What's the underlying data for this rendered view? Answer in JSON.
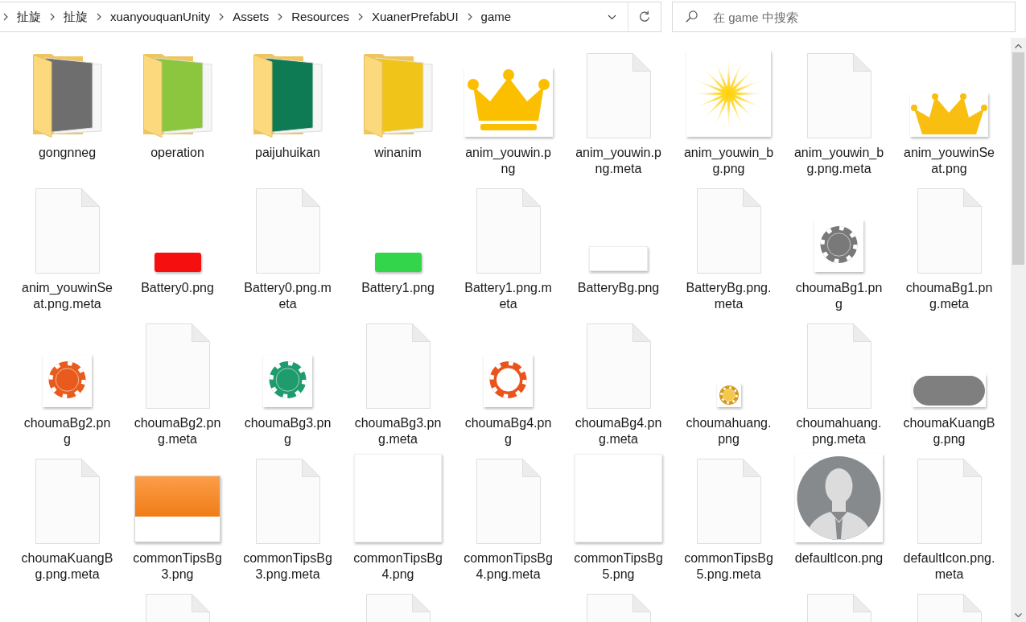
{
  "address_bar": {
    "path": [
      "扯旋",
      "扯旋",
      "xuanyouquanUnity",
      "Assets",
      "Resources",
      "XuanerPrefabUI",
      "game"
    ]
  },
  "search": {
    "placeholder": "在 game 中搜索"
  },
  "items": [
    {
      "name": "gongnneg",
      "kind": "folder",
      "color": "#6e6e6e"
    },
    {
      "name": "operation",
      "kind": "folder",
      "color": "#8cc63e"
    },
    {
      "name": "paijuhuikan",
      "kind": "folder",
      "color": "#0f7b55"
    },
    {
      "name": "winanim",
      "kind": "folder",
      "color": "#f0c419"
    },
    {
      "name": "anim_youwin.png",
      "kind": "crown"
    },
    {
      "name": "anim_youwin.png.meta",
      "kind": "document"
    },
    {
      "name": "anim_youwin_bg.png",
      "kind": "sunburst"
    },
    {
      "name": "anim_youwin_bg.png.meta",
      "kind": "document"
    },
    {
      "name": "anim_youwinSeat.png",
      "kind": "widecrown"
    },
    {
      "name": "anim_youwinSeat.png.meta",
      "kind": "document"
    },
    {
      "name": "Battery0.png",
      "kind": "bar",
      "color": "#f50f0f"
    },
    {
      "name": "Battery0.png.meta",
      "kind": "document"
    },
    {
      "name": "Battery1.png",
      "kind": "bar",
      "color": "#33d64b"
    },
    {
      "name": "Battery1.png.meta",
      "kind": "document"
    },
    {
      "name": "BatteryBg.png",
      "kind": "plate"
    },
    {
      "name": "BatteryBg.png.meta",
      "kind": "document"
    },
    {
      "name": "choumaBg1.png",
      "kind": "chip",
      "color": "#797979"
    },
    {
      "name": "choumaBg1.png.meta",
      "kind": "document"
    },
    {
      "name": "choumaBg2.png",
      "kind": "chip",
      "color": "#e95b1c"
    },
    {
      "name": "choumaBg2.png.meta",
      "kind": "document"
    },
    {
      "name": "choumaBg3.png",
      "kind": "chip",
      "color": "#1f9c6e"
    },
    {
      "name": "choumaBg3.png.meta",
      "kind": "document"
    },
    {
      "name": "choumaBg4.png",
      "kind": "ringchip"
    },
    {
      "name": "choumaBg4.png.meta",
      "kind": "document"
    },
    {
      "name": "choumahuang.png",
      "kind": "smallchip"
    },
    {
      "name": "choumahuang.png.meta",
      "kind": "document"
    },
    {
      "name": "choumaKuangBg.png",
      "kind": "pill"
    },
    {
      "name": "choumaKuangBg.png.meta",
      "kind": "document"
    },
    {
      "name": "commonTipsBg3.png",
      "kind": "banner"
    },
    {
      "name": "commonTipsBg3.png.meta",
      "kind": "document"
    },
    {
      "name": "commonTipsBg4.png",
      "kind": "blank"
    },
    {
      "name": "commonTipsBg4.png.meta",
      "kind": "document"
    },
    {
      "name": "commonTipsBg5.png",
      "kind": "blank"
    },
    {
      "name": "commonTipsBg5.png.meta",
      "kind": "document"
    },
    {
      "name": "defaultIcon.png",
      "kind": "avatar"
    },
    {
      "name": "defaultIcon.png.meta",
      "kind": "document"
    },
    {
      "kind": "empty"
    },
    {
      "kind": "document"
    },
    {
      "kind": "empty"
    },
    {
      "kind": "document"
    },
    {
      "kind": "empty"
    },
    {
      "kind": "document"
    },
    {
      "kind": "empty"
    },
    {
      "kind": "document"
    },
    {
      "kind": "document"
    }
  ]
}
